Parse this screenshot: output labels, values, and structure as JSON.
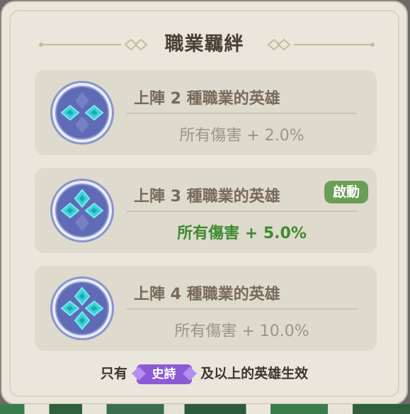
{
  "panel": {
    "title": "職業羈絆",
    "bonds": [
      {
        "condition": "上陣 2 種職業的英雄",
        "bonus": "所有傷害 + 2.0%",
        "active": false
      },
      {
        "condition": "上陣 3 種職業的英雄",
        "bonus": "所有傷害 + 5.0%",
        "active": true,
        "badge": "啟動"
      },
      {
        "condition": "上陣 4 種職業的英雄",
        "bonus": "所有傷害 + 10.0%",
        "active": false
      }
    ],
    "footer": {
      "prefix": "只有",
      "rarity": "史詩",
      "suffix": "及以上的英雄生效"
    }
  },
  "colors": {
    "active_green": "#3f8a2f",
    "badge_green": "#6a9e56",
    "epic_purple": "#8b5bd6"
  }
}
